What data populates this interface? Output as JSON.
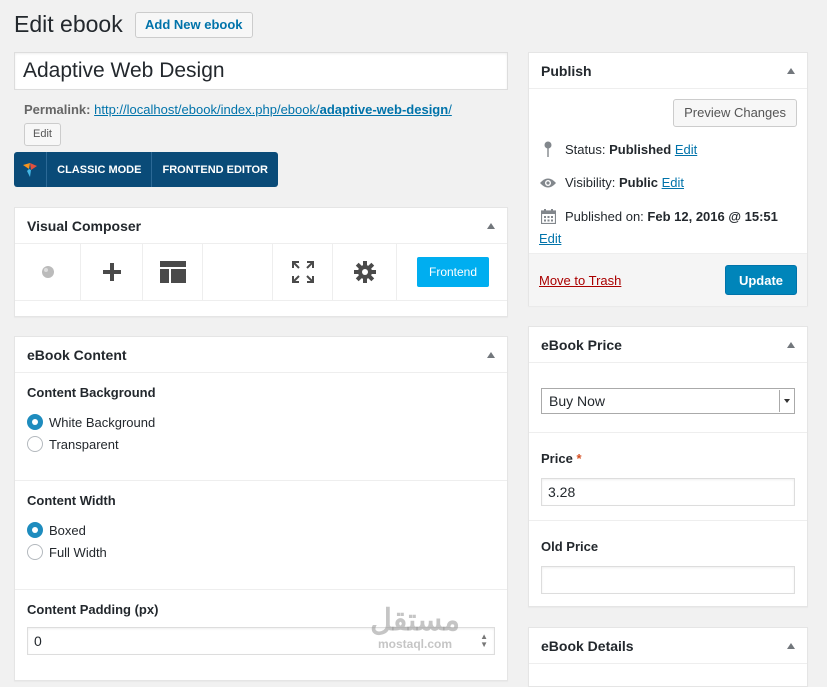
{
  "header": {
    "title": "Edit ebook",
    "add_new_label": "Add New ebook"
  },
  "post": {
    "title_value": "Adaptive Web Design",
    "permalink_label": "Permalink:",
    "permalink_base": "http://localhost/ebook/index.php/ebook/",
    "permalink_slug": "adaptive-web-design",
    "permalink_trailing": "/",
    "edit_label": "Edit"
  },
  "vc_bar": {
    "classic_label": "CLASSIC MODE",
    "frontend_label": "FRONTEND EDITOR"
  },
  "visual_composer": {
    "title": "Visual Composer",
    "frontend_button": "Frontend"
  },
  "ebook_content": {
    "title": "eBook Content",
    "background": {
      "label": "Content Background",
      "options": [
        "White Background",
        "Transparent"
      ],
      "selected": "White Background"
    },
    "width": {
      "label": "Content Width",
      "options": [
        "Boxed",
        "Full Width"
      ],
      "selected": "Boxed"
    },
    "padding": {
      "label": "Content Padding (px)",
      "value": "0"
    }
  },
  "publish": {
    "title": "Publish",
    "preview_label": "Preview Changes",
    "status_label": "Status:",
    "status_value": "Published",
    "visibility_label": "Visibility:",
    "visibility_value": "Public",
    "published_label": "Published on:",
    "published_value": "Feb 12, 2016 @ 15:51",
    "edit_label": "Edit",
    "trash_label": "Move to Trash",
    "update_label": "Update"
  },
  "ebook_price": {
    "title": "eBook Price",
    "type_selected": "Buy Now",
    "price_label": "Price",
    "required_mark": "*",
    "price_value": "3.28",
    "old_price_label": "Old Price",
    "old_price_value": ""
  },
  "ebook_details": {
    "title": "eBook Details"
  },
  "watermark": {
    "arabic": "مستقل",
    "latin": "mostaql.com"
  },
  "colors": {
    "accent": "#0073aa",
    "primary_button": "#0085ba",
    "vc_bar": "#0a4b78",
    "frontend_button": "#00aef0",
    "trash": "#a00000"
  },
  "icons": [
    "logo-icon",
    "plus-icon",
    "layout-icon",
    "fullscreen-icon",
    "gear-icon",
    "pin-icon",
    "eye-icon",
    "calendar-icon",
    "caret-up-icon"
  ]
}
